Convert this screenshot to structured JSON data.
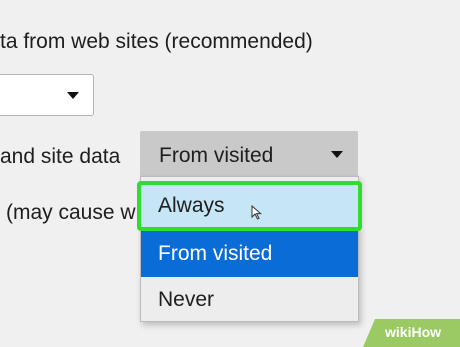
{
  "settings": {
    "partial_heading": "ta from web sites (recommended)",
    "cookies_label": "and site data",
    "third_party_text": "(may cause w",
    "cookie_select": {
      "selected_value": "From visited",
      "options": [
        "Always",
        "From visited",
        "Never"
      ],
      "hovered_option": "Always",
      "highlight_color": "#2ede2e",
      "selected_color": "#0a6cd6"
    }
  },
  "watermark": {
    "text_a": "wiki",
    "text_b": "How",
    "color": "#8cc34b"
  }
}
